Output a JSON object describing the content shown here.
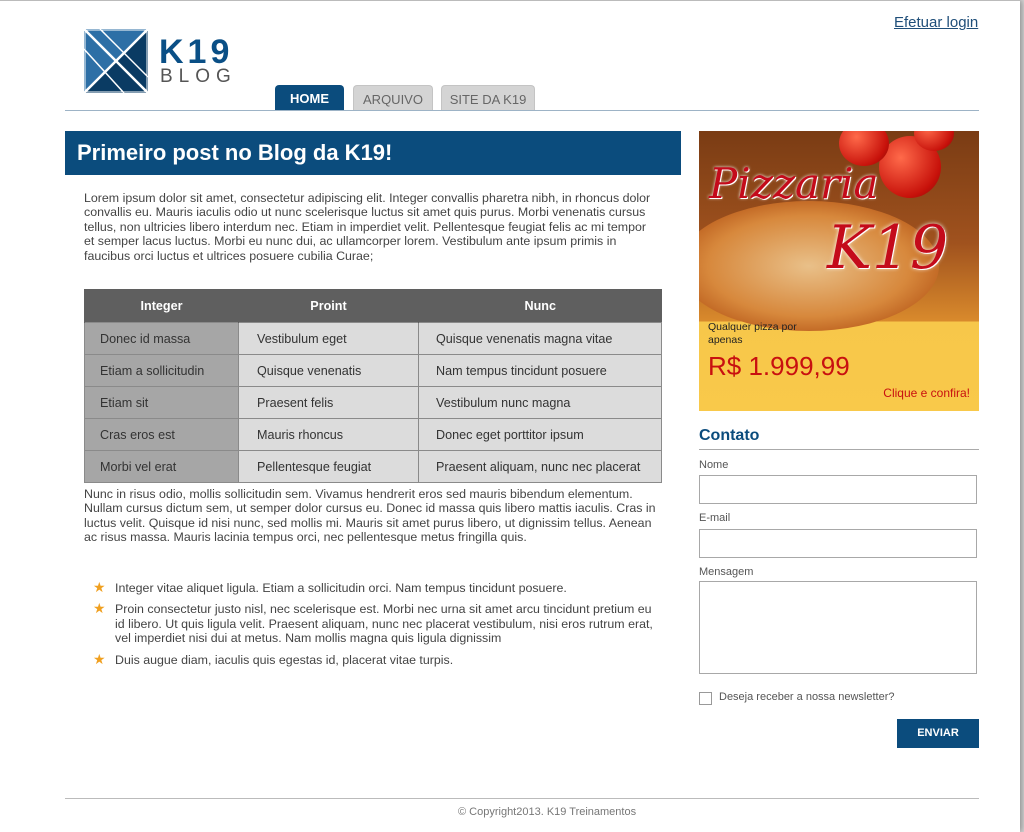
{
  "header": {
    "login_link": "Efetuar login",
    "logo_main": "K19",
    "logo_sub": "BLOG"
  },
  "nav": {
    "tabs": [
      {
        "label": "HOME",
        "active": true
      },
      {
        "label": "ARQUIVO",
        "active": false
      },
      {
        "label": "SITE DA K19",
        "active": false
      }
    ]
  },
  "post": {
    "title": "Primeiro post no Blog da K19!",
    "intro": "Lorem ipsum dolor sit amet, consectetur adipiscing elit. Integer convallis pharetra nibh, in rhoncus dolor convallis eu. Mauris iaculis odio ut nunc scelerisque luctus sit amet quis purus. Morbi venenatis cursus tellus, non ultricies libero interdum nec. Etiam in imperdiet velit. Pellentesque feugiat felis ac mi tempor et semper lacus luctus. Morbi eu nunc dui, ac ullamcorper lorem. Vestibulum ante ipsum primis in faucibus orci luctus et ultrices posuere cubilia Curae;",
    "table": {
      "headers": [
        "Integer",
        "Proint",
        "Nunc"
      ],
      "rows": [
        [
          "Donec id massa",
          "Vestibulum eget",
          "Quisque venenatis magna vitae"
        ],
        [
          "Etiam a sollicitudin",
          "Quisque venenatis",
          "Nam tempus tincidunt posuere"
        ],
        [
          "Etiam sit",
          "Praesent felis",
          "Vestibulum nunc magna"
        ],
        [
          "Cras eros est",
          "Mauris rhoncus",
          "Donec eget porttitor ipsum"
        ],
        [
          "Morbi vel erat",
          "Pellentesque feugiat",
          "Praesent aliquam, nunc nec placerat"
        ]
      ]
    },
    "body": "Nunc in risus odio, mollis sollicitudin sem. Vivamus hendrerit eros sed mauris bibendum elementum. Nullam cursus dictum sem, ut semper dolor cursus eu. Donec id massa quis libero mattis iaculis. Cras in luctus velit. Quisque id nisi nunc, sed mollis mi. Mauris sit amet purus libero, ut dignissim tellus. Aenean ac risus massa. Mauris lacinia tempus orci, nec pellentesque metus fringilla quis.",
    "bullets": [
      "Integer vitae aliquet ligula. Etiam a sollicitudin orci. Nam tempus tincidunt posuere.",
      "Proin consectetur justo nisl, nec scelerisque est. Morbi nec urna sit amet arcu tincidunt pretium eu id libero. Ut quis ligula velit. Praesent aliquam, nunc nec placerat vestibulum, nisi eros rutrum erat, vel imperdiet nisi dui at metus. Nam mollis magna quis ligula dignissim",
      "Duis augue diam, iaculis quis egestas id, placerat vitae turpis."
    ]
  },
  "ad": {
    "title_line1": "Pizzaria",
    "title_line2": "K19",
    "small_text": "Qualquer pizza por apenas",
    "price": "R$ 1.999,99",
    "cta": "Clique e confira!"
  },
  "contact": {
    "title": "Contato",
    "name_label": "Nome",
    "email_label": "E-mail",
    "message_label": "Mensagem",
    "newsletter_label": "Deseja receber a nossa newsletter?",
    "newsletter_checked": false,
    "submit_label": "ENVIAR"
  },
  "footer": {
    "copyright": "© Copyright2013. K19 Treinamentos"
  },
  "colors": {
    "brand_blue": "#0b4c7d",
    "price_red": "#c81010",
    "star": "#f0a020"
  }
}
